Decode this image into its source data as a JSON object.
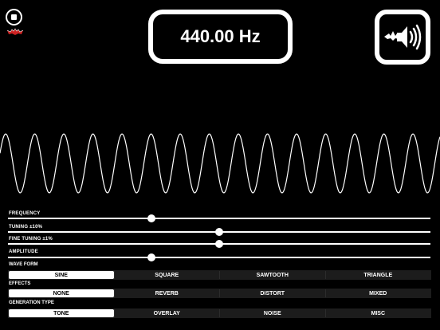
{
  "frequency_display": "440.00 Hz",
  "icons": {
    "stop": "stop-icon",
    "logo": "bat-icon",
    "speaker": "speaker-volume-icon"
  },
  "sliders": [
    {
      "label": "FREQUENCY",
      "value_fraction": 0.34
    },
    {
      "label": "TUNING ±10%",
      "value_fraction": 0.5
    },
    {
      "label": "FINE TUNING ±1%",
      "value_fraction": 0.5
    },
    {
      "label": "AMPLITUDE",
      "value_fraction": 0.34
    }
  ],
  "wave_form": {
    "label": "WAVE FORM",
    "options": [
      "SINE",
      "SQUARE",
      "SAWTOOTH",
      "TRIANGLE"
    ],
    "selected": "SINE"
  },
  "effects": {
    "label": "EFFECTS",
    "options": [
      "NONE",
      "REVERB",
      "DISTORT",
      "MIXED"
    ],
    "selected": "NONE"
  },
  "generation_type": {
    "label": "GENERATION TYPE",
    "options": [
      "TONE",
      "OVERLAY",
      "NOISE",
      "MISC"
    ],
    "selected": "TONE"
  },
  "colors": {
    "background": "#000000",
    "foreground": "#ffffff",
    "segment_bg": "#1c1c1c",
    "logo_accent": "#cc2222"
  }
}
